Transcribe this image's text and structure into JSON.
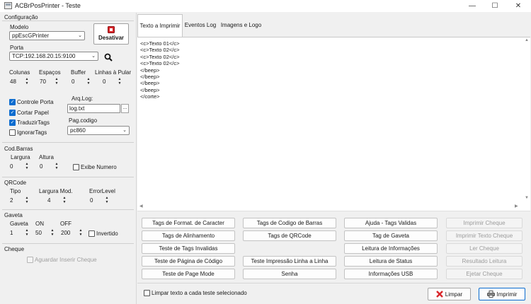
{
  "window": {
    "title": "ACBrPosPrinter - Teste",
    "minimize": "—",
    "maximize": "☐",
    "close": "✕"
  },
  "config": {
    "section": "Configuração",
    "modelo_label": "Modelo",
    "modelo_value": "ppEscGPrinter",
    "porta_label": "Porta",
    "porta_value": "TCP:192.168.20.15:9100",
    "desativar_label": "Desativar",
    "colunas_label": "Colunas",
    "colunas_value": "48",
    "espacos_label": "Espaços",
    "espacos_value": "70",
    "buffer_label": "Buffer",
    "buffer_value": "0",
    "linhas_label": "Linhas à Pular",
    "linhas_value": "0",
    "controle_porta": "Controle Porta",
    "cortar_papel": "Cortar Papel",
    "traduzir_tags": "TraduzirTags",
    "ignorar_tags": "IgnorarTags",
    "arqlog_label": "Arq.Log:",
    "arqlog_value": "log.txt",
    "arqlog_btn": "...",
    "pagcodigo_label": "Pag.codigo",
    "pagcodigo_value": "pc860"
  },
  "codbarras": {
    "section": "Cod.Barras",
    "largura_label": "Largura",
    "largura_value": "0",
    "altura_label": "Altura",
    "altura_value": "0",
    "exibe_numero": "Exibe Numero"
  },
  "qrcode": {
    "section": "QRCode",
    "tipo_label": "Tipo",
    "tipo_value": "2",
    "largura_label": "Largura Mod.",
    "largura_value": "4",
    "error_label": "ErrorLevel",
    "error_value": "0"
  },
  "gaveta": {
    "section": "Gaveta",
    "gaveta_label": "Gaveta",
    "gaveta_value": "1",
    "on_label": "ON",
    "on_value": "50",
    "off_label": "OFF",
    "off_value": "200",
    "invertido": "Invertido"
  },
  "cheque": {
    "section": "Cheque",
    "aguardar": "Aguardar Inserir Cheque"
  },
  "tabs": [
    "Texto a Imprimir",
    "Eventos Log",
    "Imagens e Logo"
  ],
  "memo_lines": [
    "<c>Texto 01</c>",
    "<c>Texto 02</c>",
    "<c>Texto 02</c>",
    "<c>Texto 02</c>",
    "</beep>",
    "</beep>",
    "</beep>",
    "</beep>",
    "</corte>"
  ],
  "buttons": {
    "col1": [
      "Tags de Format. de Caracter",
      "Tags de Alinhamento",
      "Teste de Tags Invalidas",
      "Teste de Página de Código",
      "Teste de Page Mode"
    ],
    "col2": [
      "Tags de Codigo de Barras",
      "Tags de QRCode",
      "",
      "Teste Impressão Linha a Linha",
      "Senha"
    ],
    "col3": [
      "Ajuda - Tags Validas",
      "Tag de Gaveta",
      "Leitura de Informações",
      "Leitura de Status",
      "Informações USB"
    ],
    "col4": [
      "Imprimir Cheque",
      "Imprimir Texto Cheque",
      "Ler Cheque",
      "Resultado Leitura",
      "Ejetar Cheque"
    ]
  },
  "footer": {
    "limpar_check": "Limpar texto a cada teste selecionado",
    "limpar_btn": "Limpar",
    "imprimir_btn": "Imprimir"
  },
  "colors": {
    "accent": "#0b6ccf",
    "error_red": "#d9262a"
  }
}
